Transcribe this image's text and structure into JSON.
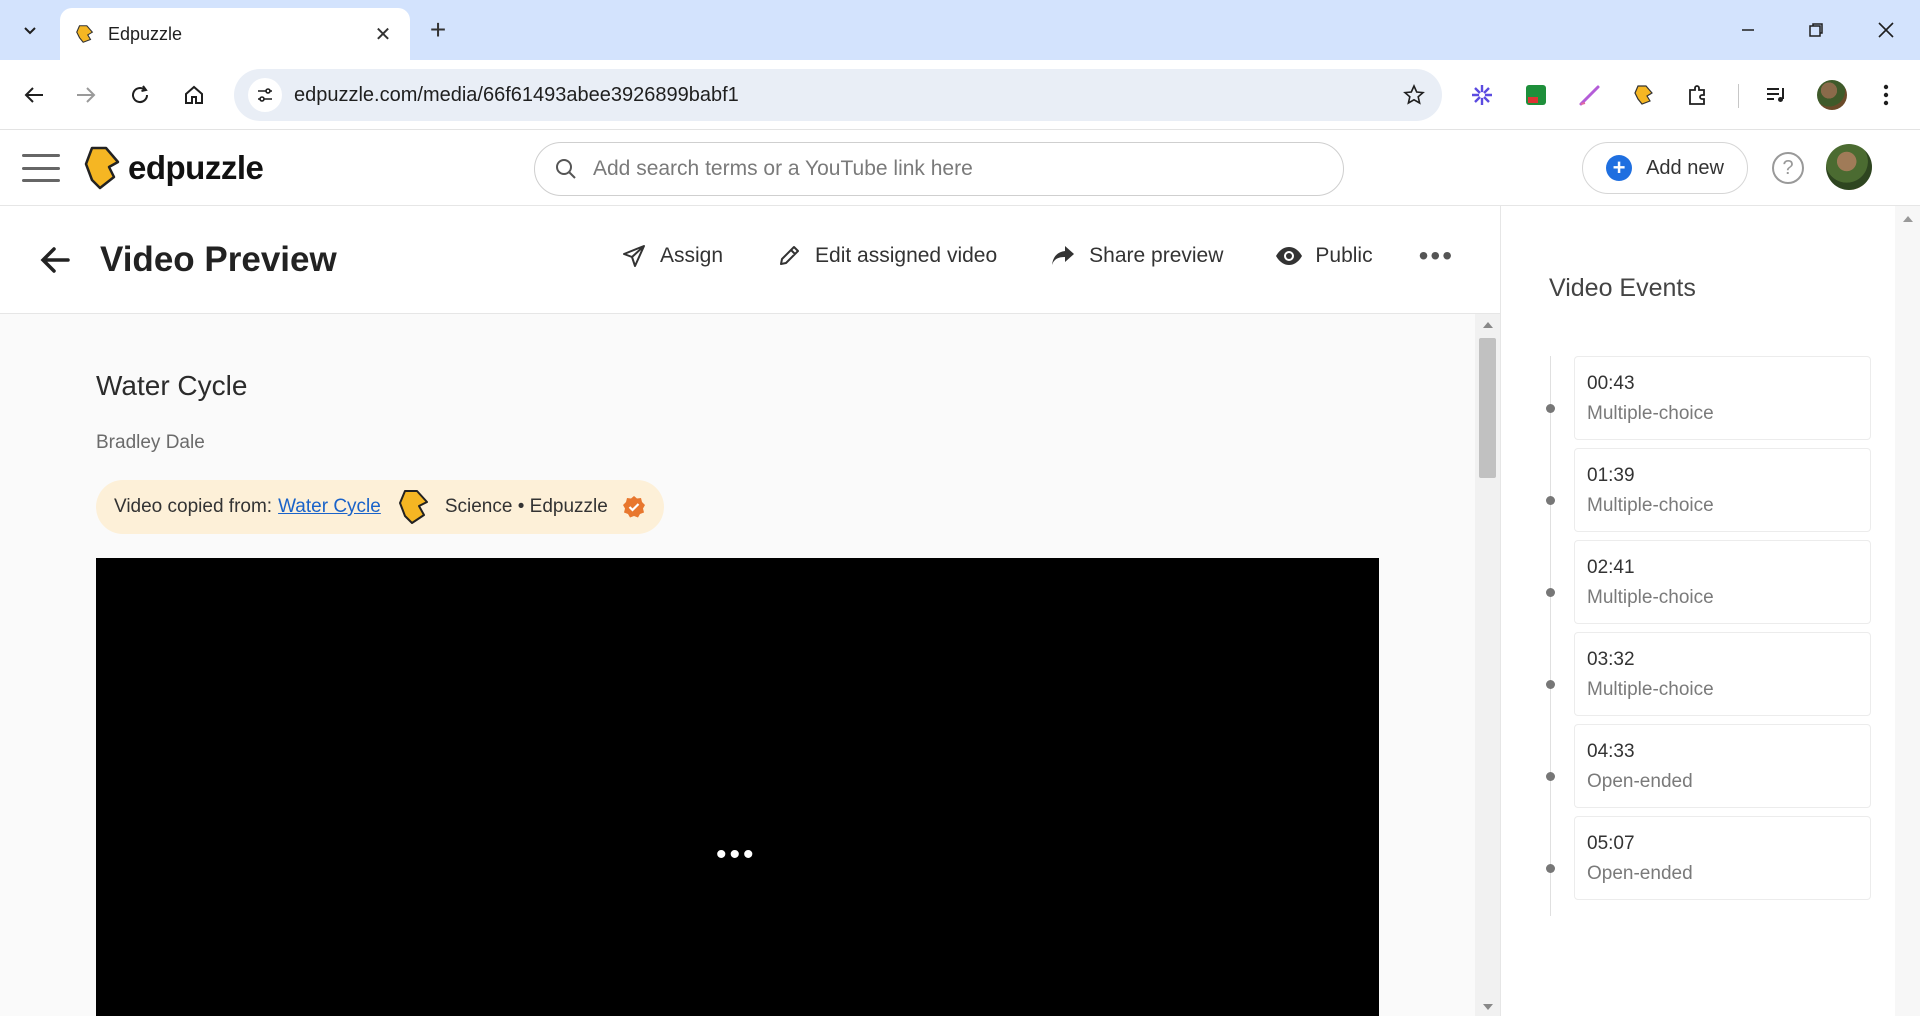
{
  "browser": {
    "tab_title": "Edpuzzle",
    "url": "edpuzzle.com/media/66f61493abee3926899babf1"
  },
  "app": {
    "logo_text": "edpuzzle",
    "search_placeholder": "Add search terms or a YouTube link here",
    "add_new_label": "Add new",
    "help_label": "?"
  },
  "page": {
    "title": "Video Preview",
    "actions": [
      {
        "label": "Assign",
        "icon": "send-icon"
      },
      {
        "label": "Edit assigned video",
        "icon": "pencil-icon"
      },
      {
        "label": "Share preview",
        "icon": "share-icon"
      },
      {
        "label": "Public",
        "icon": "eye-icon"
      }
    ],
    "more_label": "•••"
  },
  "video": {
    "title": "Water Cycle",
    "author": "Bradley Dale",
    "copied_label": "Video copied from:",
    "copied_link": "Water Cycle",
    "channel": "Science • Edpuzzle",
    "loading_label": "•••"
  },
  "events": {
    "title": "Video Events",
    "items": [
      {
        "time": "00:43",
        "type": "Multiple-choice"
      },
      {
        "time": "01:39",
        "type": "Multiple-choice"
      },
      {
        "time": "02:41",
        "type": "Multiple-choice"
      },
      {
        "time": "03:32",
        "type": "Multiple-choice"
      },
      {
        "time": "04:33",
        "type": "Open-ended"
      },
      {
        "time": "05:07",
        "type": "Open-ended"
      }
    ]
  },
  "colors": {
    "accent_blue": "#1f6fe0",
    "brand_yellow": "#f5b623",
    "copied_pill_bg": "#fdf0d8",
    "link": "#1a63c9",
    "verified_orange": "#e8772e"
  }
}
